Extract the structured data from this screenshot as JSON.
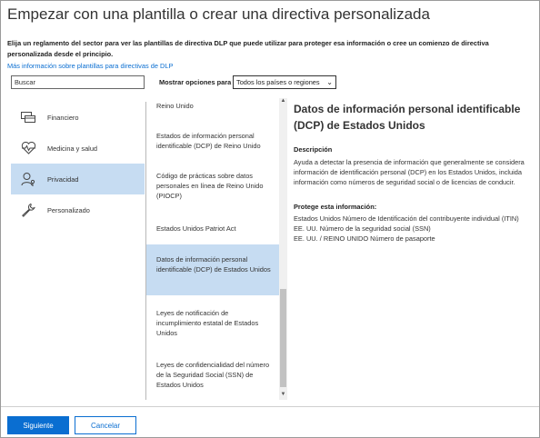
{
  "dialog": {
    "title": "Empezar con una plantilla o crear una directiva personalizada",
    "intro": "Elija un reglamento del sector para ver las plantillas de directiva DLP que puede utilizar para proteger esa información o cree un comienzo de directiva personalizada desde el principio.",
    "more_link": "Más información sobre plantillas para directivas de DLP"
  },
  "search": {
    "placeholder": "Buscar"
  },
  "filter": {
    "label": "Mostrar opciones para",
    "selected": "Todos los países o regiones"
  },
  "categories": [
    {
      "label": "Financiero",
      "icon": "card-icon",
      "selected": false
    },
    {
      "label": "Medicina y salud",
      "icon": "heart-pulse-icon",
      "selected": false
    },
    {
      "label": "Privacidad",
      "icon": "person-key-icon",
      "selected": true
    },
    {
      "label": "Personalizado",
      "icon": "wrench-icon",
      "selected": false
    }
  ],
  "templates": [
    {
      "label": "Reino Unido",
      "selected": false
    },
    {
      "label": "Estados de información personal identificable (DCP) de Reino Unido",
      "selected": false
    },
    {
      "label": "Código de prácticas sobre datos personales en línea de Reino Unido (PIOCP)",
      "selected": false
    },
    {
      "label": "Estados Unidos Patriot Act",
      "selected": false
    },
    {
      "label": "Datos de información personal identificable (DCP) de  Estados Unidos",
      "selected": true
    },
    {
      "label": "Leyes  de notificación de incumplimiento estatal de Estados Unidos",
      "selected": false
    },
    {
      "label": "Leyes  de confidencialidad del número de la Seguridad Social (SSN) de Estados Unidos",
      "selected": false
    }
  ],
  "detail": {
    "title": "Datos de información personal identificable (DCP) de  Estados Unidos",
    "description_heading": "Descripción",
    "description": "Ayuda a detectar la presencia de información que generalmente se considera información de identificación personal (DCP) en los Estados Unidos, incluida información como números de seguridad social o de licencias de conducir.",
    "protects_heading": "Protege esta información:",
    "protects": [
      "Estados Unidos Número de Identificación del contribuyente individual (ITIN)",
      "EE. UU. Número de la seguridad social (SSN)",
      "EE. UU. / REINO UNIDO Número de pasaporte"
    ]
  },
  "buttons": {
    "next": "Siguiente",
    "cancel": "Cancelar"
  },
  "colors": {
    "accent": "#0a6ed1",
    "selection": "#c6dcf2"
  }
}
